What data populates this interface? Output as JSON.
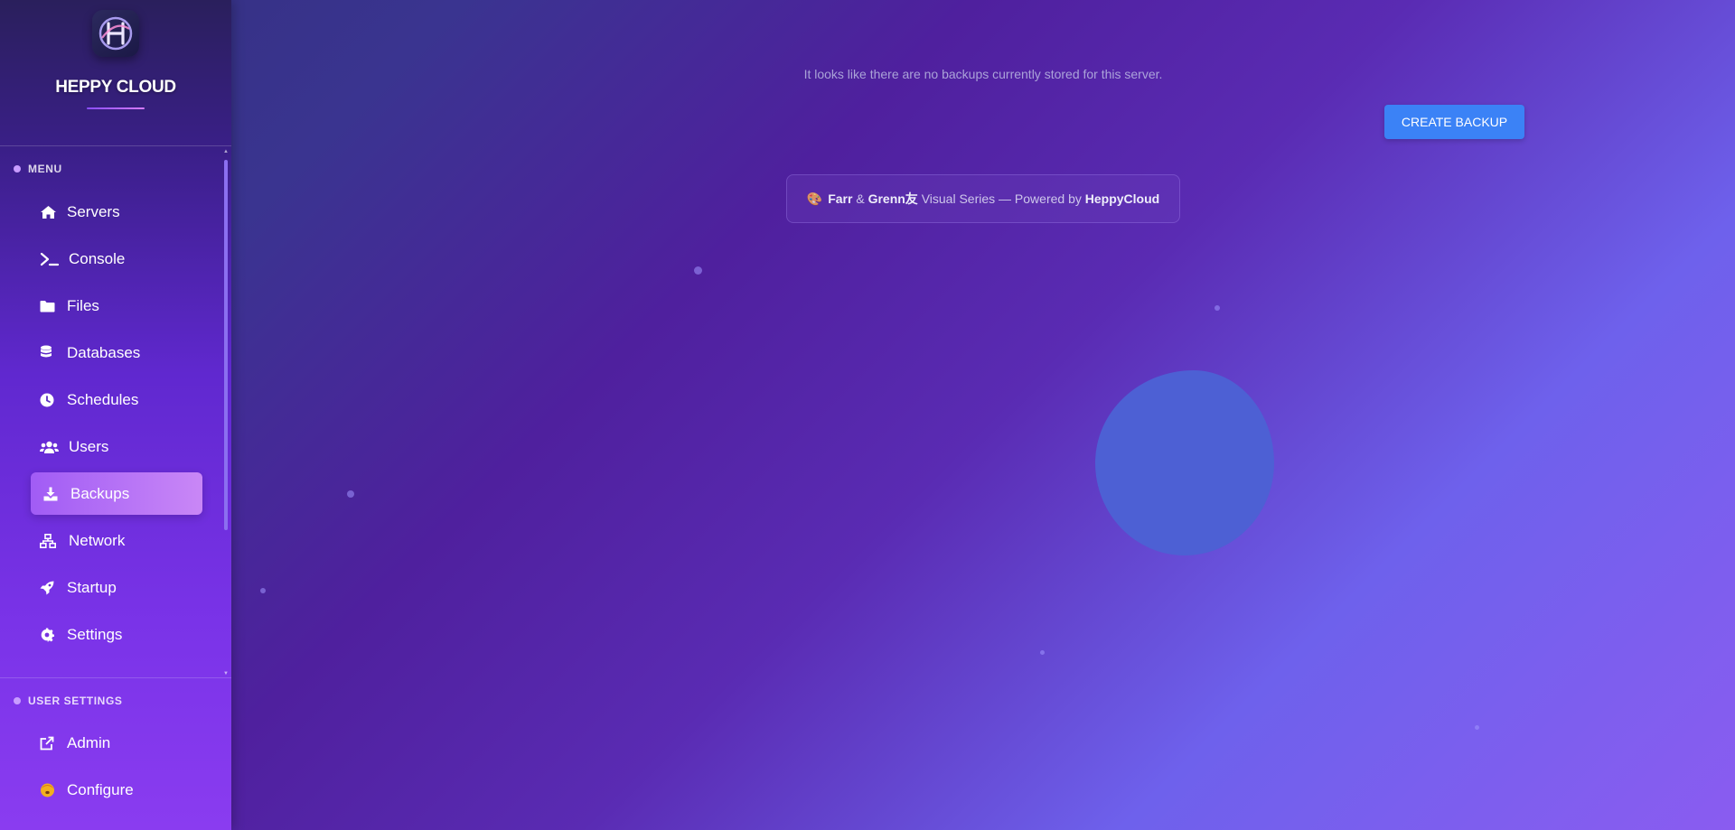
{
  "brand": {
    "name": "HEPPY CLOUD",
    "logo_icon": "heppy-cloud-logo-icon"
  },
  "sidebar": {
    "menu_heading": "MENU",
    "items": [
      {
        "label": "Servers",
        "icon": "home-icon",
        "active": false
      },
      {
        "label": "Console",
        "icon": "terminal-icon",
        "active": false
      },
      {
        "label": "Files",
        "icon": "folder-icon",
        "active": false
      },
      {
        "label": "Databases",
        "icon": "database-icon",
        "active": false
      },
      {
        "label": "Schedules",
        "icon": "clock-icon",
        "active": false
      },
      {
        "label": "Users",
        "icon": "users-icon",
        "active": false
      },
      {
        "label": "Backups",
        "icon": "download-icon",
        "active": true
      },
      {
        "label": "Network",
        "icon": "network-icon",
        "active": false
      },
      {
        "label": "Startup",
        "icon": "rocket-icon",
        "active": false
      },
      {
        "label": "Settings",
        "icon": "gear-icon",
        "active": false
      }
    ],
    "user_settings_heading": "USER SETTINGS",
    "user_items": [
      {
        "label": "Admin",
        "icon": "external-link-icon"
      },
      {
        "label": "Configure",
        "icon": "configure-emoji-icon"
      }
    ]
  },
  "main": {
    "empty_message": "It looks like there are no backups currently stored for this server.",
    "create_button_label": "CREATE BACKUP",
    "credit": {
      "emoji": "🎨",
      "author_a": "Farr",
      "amp": " & ",
      "author_b": "Grenn友",
      "middle": " Visual Series — Powered by ",
      "brand": "HeppyCloud"
    }
  },
  "colors": {
    "accent_button": "#3b82f6",
    "active_nav": "#b06ff5",
    "sidebar_top": "#2a1f5c",
    "sidebar_bottom": "#8a3cf0"
  }
}
